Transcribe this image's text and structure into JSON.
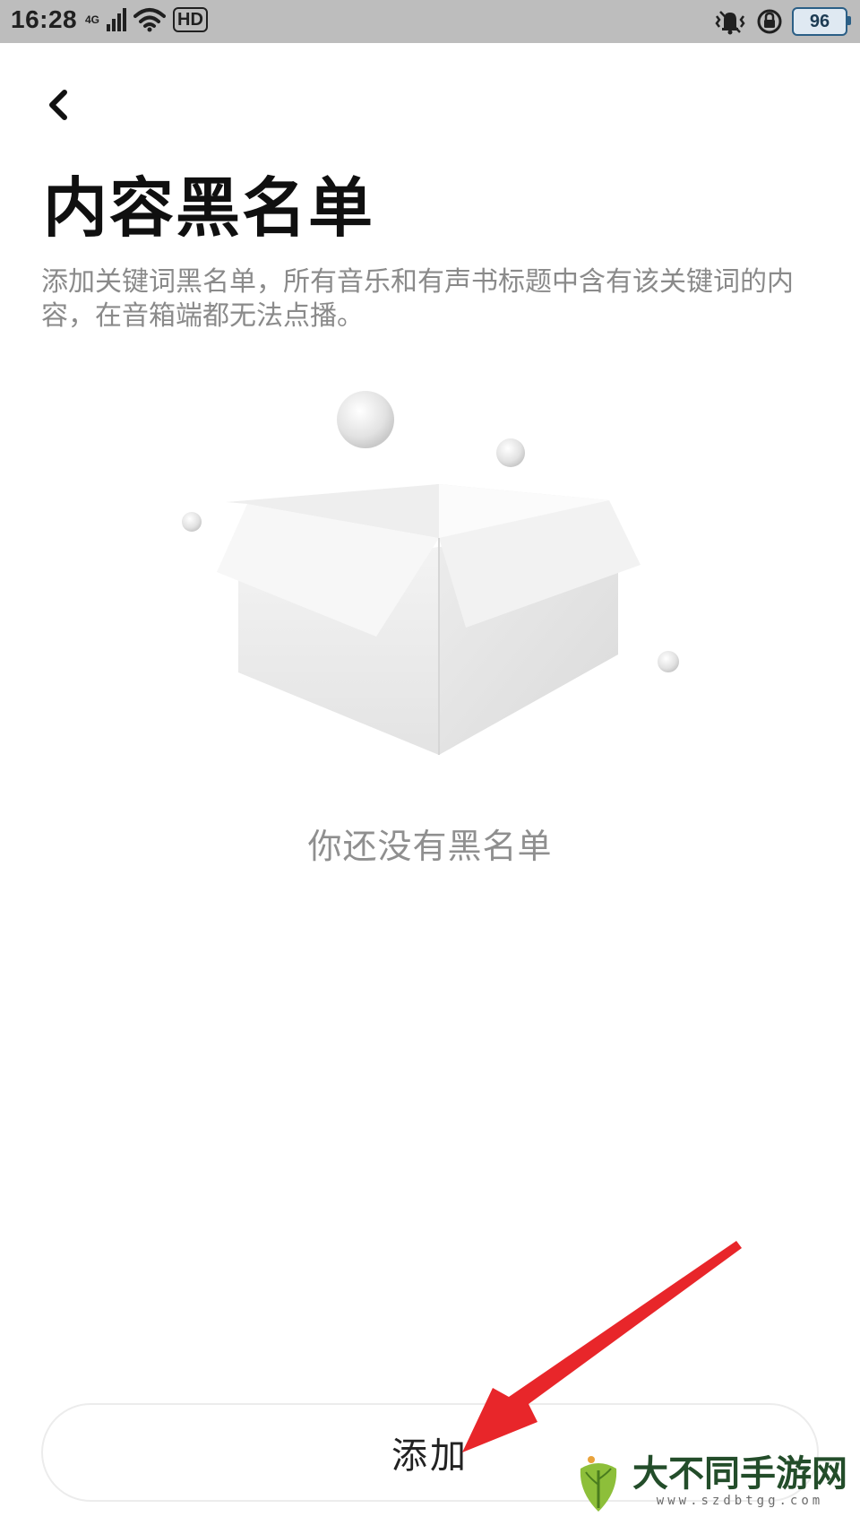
{
  "status_bar": {
    "time": "16:28",
    "network_type": "4G",
    "hd_label": "HD",
    "battery_level": "96"
  },
  "header": {
    "back_icon": "chevron-left-icon",
    "title": "内容黑名单"
  },
  "description": "添加关键词黑名单，所有音乐和有声书标题中含有该关键词的内容，在音箱端都无法点播。",
  "empty_state": {
    "illustration_icon": "empty-box-icon",
    "message": "你还没有黑名单"
  },
  "actions": {
    "add_label": "添加"
  },
  "annotation": {
    "arrow_color": "#e8262a"
  },
  "watermark": {
    "title": "大不同手游网",
    "url": "www.szdbtgg.com"
  },
  "colors": {
    "status_bar": "#bdbdbd",
    "title": "#101010",
    "description": "#8a8a8a",
    "empty_text": "#8f8f8f",
    "accent_arrow": "#e8262a"
  }
}
